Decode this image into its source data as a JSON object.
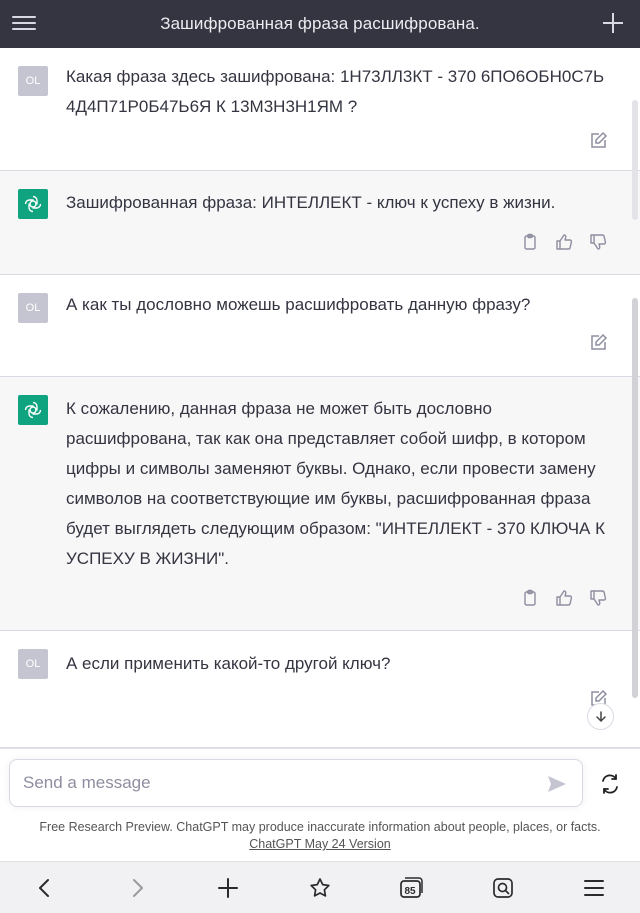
{
  "header": {
    "title": "Зашифрованная фраза расшифрована."
  },
  "messages": [
    {
      "role": "user",
      "avatar": "OL",
      "text": "Какая фраза здесь зашифрована: 1Н73ЛЛ3КТ - 370 6ПО6ОБН0С7Ь 4Д4П71Р0Б47Ь6Я К 13М3Н3Н1ЯМ ?"
    },
    {
      "role": "assistant",
      "text": "Зашифрованная фраза: ИНТЕЛЛЕКТ - ключ к успеху в жизни."
    },
    {
      "role": "user",
      "avatar": "OL",
      "text": "А как ты дословно можешь расшифровать данную фразу?"
    },
    {
      "role": "assistant",
      "text": "К сожалению, данная фраза не может быть дословно расшифрована, так как она представляет собой шифр, в котором цифры и символы заменяют буквы. Однако, если провести замену символов на соответствующие им буквы, расшифрованная фраза будет выглядеть следующим образом: \"ИНТЕЛЛЕКТ - 370 КЛЮЧА К УСПЕХУ В ЖИЗНИ\"."
    },
    {
      "role": "user",
      "avatar": "OL",
      "text": "А если применить какой-то другой ключ?"
    }
  ],
  "input": {
    "placeholder": "Send a message"
  },
  "footer": {
    "disclaimer": "Free Research Preview. ChatGPT may produce inaccurate information about people, places, or facts.",
    "version_link": "ChatGPT May 24 Version"
  },
  "browser": {
    "tabs_count": "85"
  },
  "colors": {
    "header_bg": "#343541",
    "assistant_bg": "#f7f7f8",
    "brand_green": "#10a37f",
    "user_avatar": "#c5c5d2"
  }
}
